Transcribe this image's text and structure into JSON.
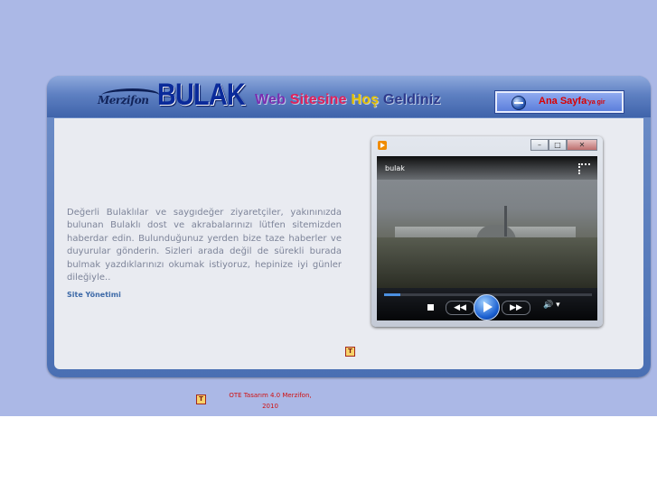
{
  "header": {
    "logo_script": "Merzifon",
    "logo_main": "BULAK",
    "welcome": [
      {
        "text": "Web ",
        "color": "#7a2fb0"
      },
      {
        "text": "Sitesine ",
        "color": "#e0205a"
      },
      {
        "text": "Hoş ",
        "color": "#e4c100"
      },
      {
        "text": "Geldiniz",
        "color": "#2d3a8c"
      }
    ],
    "home_button": {
      "label": "Ana Sayfa",
      "suffix": "'ya gir",
      "icon": "globe-icon"
    }
  },
  "intro": {
    "text": "Değerli Bulaklılar ve saygıdeğer ziyaretçiler, yakınınızda bulunan Bulaklı dost ve akrabalarınızı lütfen sitemizden haberdar edin. Bulunduğunuz yerden bize taze haberler ve duyurular gönderin. Sizleri arada değil de sürekli burada bulmak yazdıklarınızı okumak istiyoruz, hepinize iyi günler dileğiyle..",
    "signature": "Site Yönetimi"
  },
  "player": {
    "app_icon": "media-player-icon",
    "title": "bulak",
    "progress": 0.08,
    "window_controls": {
      "minimize": "–",
      "maximize": "□",
      "close": "✕"
    },
    "controls": {
      "stop": "stop-icon",
      "previous": "◀◀",
      "play": "play-icon",
      "next": "▶▶",
      "volume": "🔊 ▾"
    }
  },
  "body_icon": "small-badge-icon",
  "footer": {
    "icon": "small-badge-icon",
    "text_line1": "OTE Tasarım 4.0 Merzifon,",
    "text_line2": "2010"
  },
  "colors": {
    "page_bg": "#abb8e6",
    "panel_frame": "#4a6fb3",
    "panel_body": "#e9ebf1",
    "logo": "#0a2a9a",
    "home_label": "#d90000",
    "footer_text": "#d01010"
  }
}
